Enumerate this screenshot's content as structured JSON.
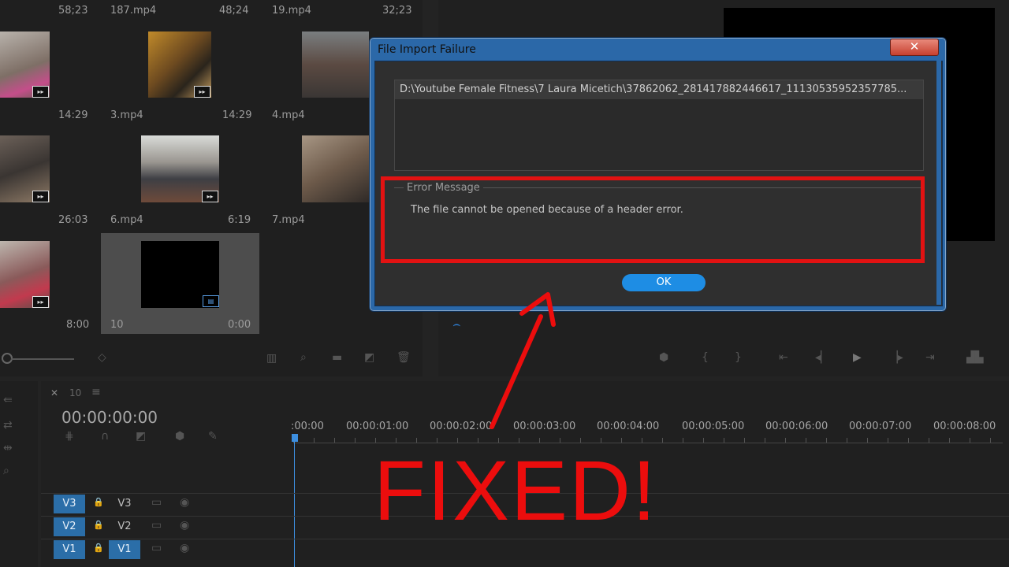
{
  "project": {
    "top_row": [
      {
        "name": "",
        "duration": "58;23"
      },
      {
        "name": "187.mp4",
        "duration": "48;24"
      },
      {
        "name": "19.mp4",
        "duration": "32;23"
      }
    ],
    "rows": [
      [
        {
          "name": "",
          "duration": "14:29"
        },
        {
          "name": "3.mp4",
          "duration": "14:29"
        },
        {
          "name": "4.mp4",
          "duration": ""
        }
      ],
      [
        {
          "name": "",
          "duration": "26:03"
        },
        {
          "name": "6.mp4",
          "duration": "6:19"
        },
        {
          "name": "7.mp4",
          "duration": ""
        }
      ],
      [
        {
          "name": "",
          "duration": "8:00"
        },
        {
          "name": "10",
          "duration": "0:00"
        }
      ]
    ]
  },
  "dialog": {
    "title": "File Import Failure",
    "close_label": "✕",
    "file_path": "D:\\Youtube Female Fitness\\7 Laura Micetich\\37862062_281417882446617_11130535952357785...",
    "error_legend": "Error Message",
    "error_text": "The file cannot be opened because of a header error.",
    "ok_label": "OK"
  },
  "timeline": {
    "tab_label": "10",
    "timecode": "00:00:00:00",
    "ruler": [
      ":00:00",
      "00:00:01:00",
      "00:00:02:00",
      "00:00:03:00",
      "00:00:04:00",
      "00:00:05:00",
      "00:00:06:00",
      "00:00:07:00",
      "00:00:08:00"
    ],
    "tracks": [
      {
        "id": "V3",
        "label": "V3"
      },
      {
        "id": "V2",
        "label": "V2"
      },
      {
        "id": "V1",
        "label": "V1"
      }
    ]
  },
  "overlay": {
    "text": "FIXED!",
    "color": "#ec0d0d"
  },
  "colors": {
    "accent": "#2b6ea8",
    "ok_button": "#1e8de4",
    "highlight": "#e21212"
  }
}
